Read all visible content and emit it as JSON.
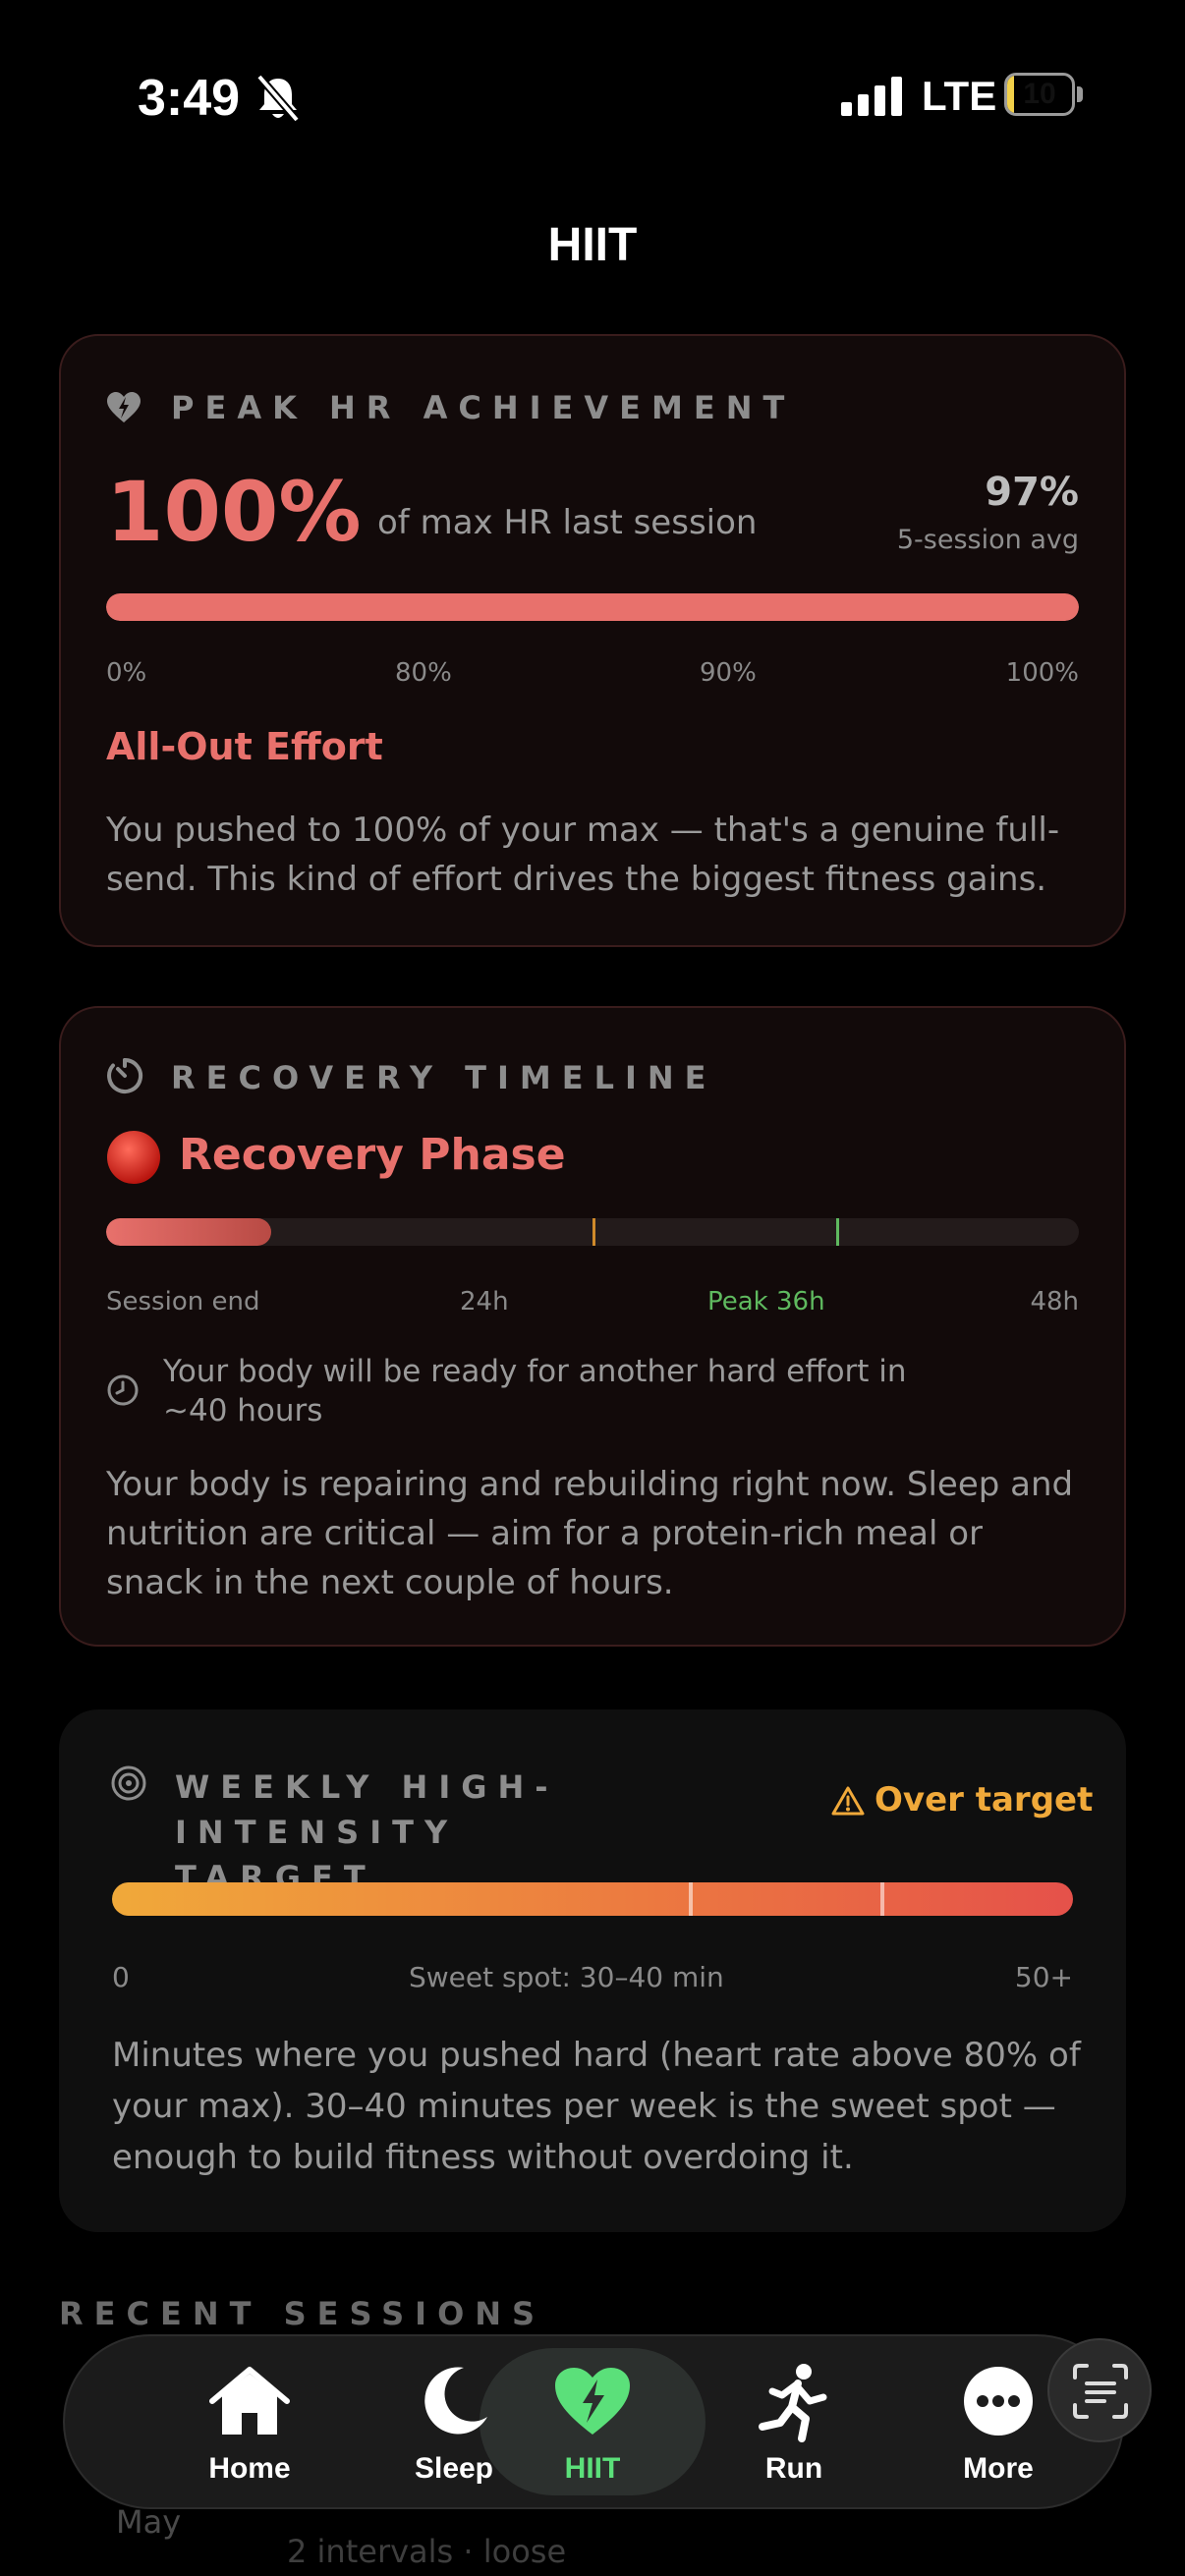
{
  "status_bar": {
    "time": "3:49",
    "network": "LTE",
    "battery": "10",
    "battery_level": 0.1
  },
  "header": {
    "title": "HIIT"
  },
  "peak_hr": {
    "heading": "PEAK HR ACHIEVEMENT",
    "value": "100%",
    "value_caption": "of max HR last session",
    "avg_value": "97%",
    "avg_caption": "5-session avg",
    "fill_percent": 100,
    "ticks": [
      "0%",
      "80%",
      "90%",
      "100%"
    ],
    "level_title": "All-Out Effort",
    "description": "You pushed to 100% of your max — that's a genuine full-send. This kind of effort drives the biggest fitness gains."
  },
  "recovery": {
    "heading": "RECOVERY TIMELINE",
    "phase": "Recovery Phase",
    "progress_fraction": 0.17,
    "marker_hours": [
      24,
      36
    ],
    "total_hours": 48,
    "ticks": [
      "Session end",
      "24h",
      "Peak 36h",
      "48h"
    ],
    "ready_note": "Your body will be ready for another hard effort in ~40 hours",
    "description": "Your body is repairing and rebuilding right now. Sleep and nutrition are critical — aim for a protein-rich meal or snack in the next couple of hours."
  },
  "weekly": {
    "heading": "WEEKLY HIGH-INTENSITY TARGET",
    "status": "Over target",
    "sweet_spot_min": [
      30,
      40
    ],
    "scale_max": 50,
    "ticks": [
      "0",
      "Sweet spot: 30–40 min",
      "50+"
    ],
    "description": "Minutes where you pushed hard (heart rate above 80% of your max). 30–40 minutes per week is the sweet spot — enough to build fitness without overdoing it."
  },
  "recent": {
    "heading": "RECENT SESSIONS",
    "month": "May",
    "peek_text": "2 intervals · loose"
  },
  "colors": {
    "accent_red": "#e8716c",
    "warning_orange": "#f0a93a",
    "good_green": "#5fb95f",
    "nav_green": "#5be07a"
  },
  "nav": {
    "items": [
      {
        "label": "Home",
        "icon": "home-icon"
      },
      {
        "label": "Sleep",
        "icon": "moon-icon"
      },
      {
        "label": "HIIT",
        "icon": "heart-bolt-icon",
        "active": true
      },
      {
        "label": "Run",
        "icon": "runner-icon"
      },
      {
        "label": "More",
        "icon": "more-icon"
      }
    ]
  }
}
